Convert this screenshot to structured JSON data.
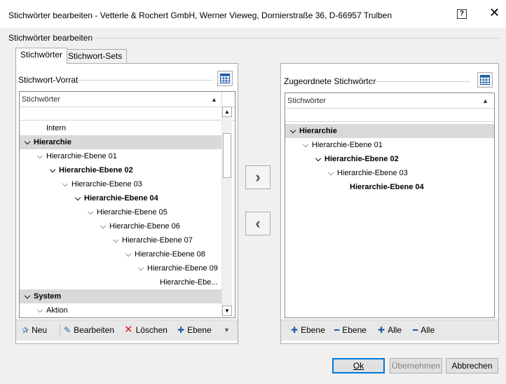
{
  "window": {
    "title": "Stichwörter bearbeiten - Vetterle & Rochert GmbH, Werner Vieweg, Dornierstraße 36, D-66957 Trulben",
    "help_icon": "?",
    "close_icon": "✕"
  },
  "section_label": "Stichwörter bearbeiten",
  "tabs": [
    {
      "label": "Stichwörter",
      "active": true
    },
    {
      "label": "Stichwort-Sets",
      "active": false
    }
  ],
  "left": {
    "title": "Stichwort-Vorrat",
    "column_header": "Stichwörter",
    "rows": [
      {
        "label": "Intern",
        "level": 1,
        "expanded": null,
        "bold": false,
        "selected": false
      },
      {
        "label": "Hierarchie",
        "level": 0,
        "expanded": true,
        "bold": true,
        "selected": true
      },
      {
        "label": "Hierarchie-Ebene 01",
        "level": 1,
        "expanded": true,
        "bold": false,
        "selected": false
      },
      {
        "label": "Hierarchie-Ebene 02",
        "level": 2,
        "expanded": true,
        "bold": true,
        "selected": false
      },
      {
        "label": "Hierarchie-Ebene 03",
        "level": 3,
        "expanded": true,
        "bold": false,
        "selected": false
      },
      {
        "label": "Hierarchie-Ebene 04",
        "level": 4,
        "expanded": true,
        "bold": true,
        "selected": false
      },
      {
        "label": "Hierarchie-Ebene 05",
        "level": 5,
        "expanded": true,
        "bold": false,
        "selected": false
      },
      {
        "label": "Hierarchie-Ebene 06",
        "level": 6,
        "expanded": true,
        "bold": false,
        "selected": false
      },
      {
        "label": "Hierarchie-Ebene 07",
        "level": 7,
        "expanded": true,
        "bold": false,
        "selected": false
      },
      {
        "label": "Hierarchie-Ebene 08",
        "level": 8,
        "expanded": true,
        "bold": false,
        "selected": false
      },
      {
        "label": "Hierarchie-Ebene 09",
        "level": 9,
        "expanded": true,
        "bold": false,
        "selected": false
      },
      {
        "label": "Hierarchie-Ebe...",
        "level": 10,
        "expanded": null,
        "bold": false,
        "selected": false
      },
      {
        "label": "System",
        "level": 0,
        "expanded": true,
        "bold": true,
        "selected": true
      },
      {
        "label": "Aktion",
        "level": 1,
        "expanded": true,
        "bold": false,
        "selected": false
      }
    ],
    "toolbar": {
      "new_label": "Neu",
      "edit_label": "Bearbeiten",
      "delete_label": "Löschen",
      "level_label": "Ebene"
    }
  },
  "right": {
    "title": "Zugeordnete Stichwörter",
    "column_header": "Stichwörter",
    "rows": [
      {
        "label": "Hierarchie",
        "level": 0,
        "expanded": true,
        "bold": true,
        "selected": true
      },
      {
        "label": "Hierarchie-Ebene 01",
        "level": 1,
        "expanded": true,
        "bold": false,
        "selected": false
      },
      {
        "label": "Hierarchie-Ebene 02",
        "level": 2,
        "expanded": true,
        "bold": true,
        "selected": false
      },
      {
        "label": "Hierarchie-Ebene 03",
        "level": 3,
        "expanded": true,
        "bold": false,
        "selected": false
      },
      {
        "label": "Hierarchie-Ebene 04",
        "level": 4,
        "expanded": null,
        "bold": true,
        "selected": false
      }
    ],
    "toolbar": {
      "plus_level_label": "Ebene",
      "minus_level_label": "Ebene",
      "plus_all_label": "Alle",
      "minus_all_label": "Alle"
    }
  },
  "move_buttons": {
    "right": "›",
    "left": "‹"
  },
  "footer": {
    "ok_label": "Ok",
    "apply_label": "Übernehmen",
    "cancel_label": "Abbrechen"
  },
  "colors": {
    "accent_blue": "#1e5aa8",
    "delete_red": "#e02020",
    "selection_gray": "#d9d9d9",
    "focus_border": "#0078d7"
  }
}
